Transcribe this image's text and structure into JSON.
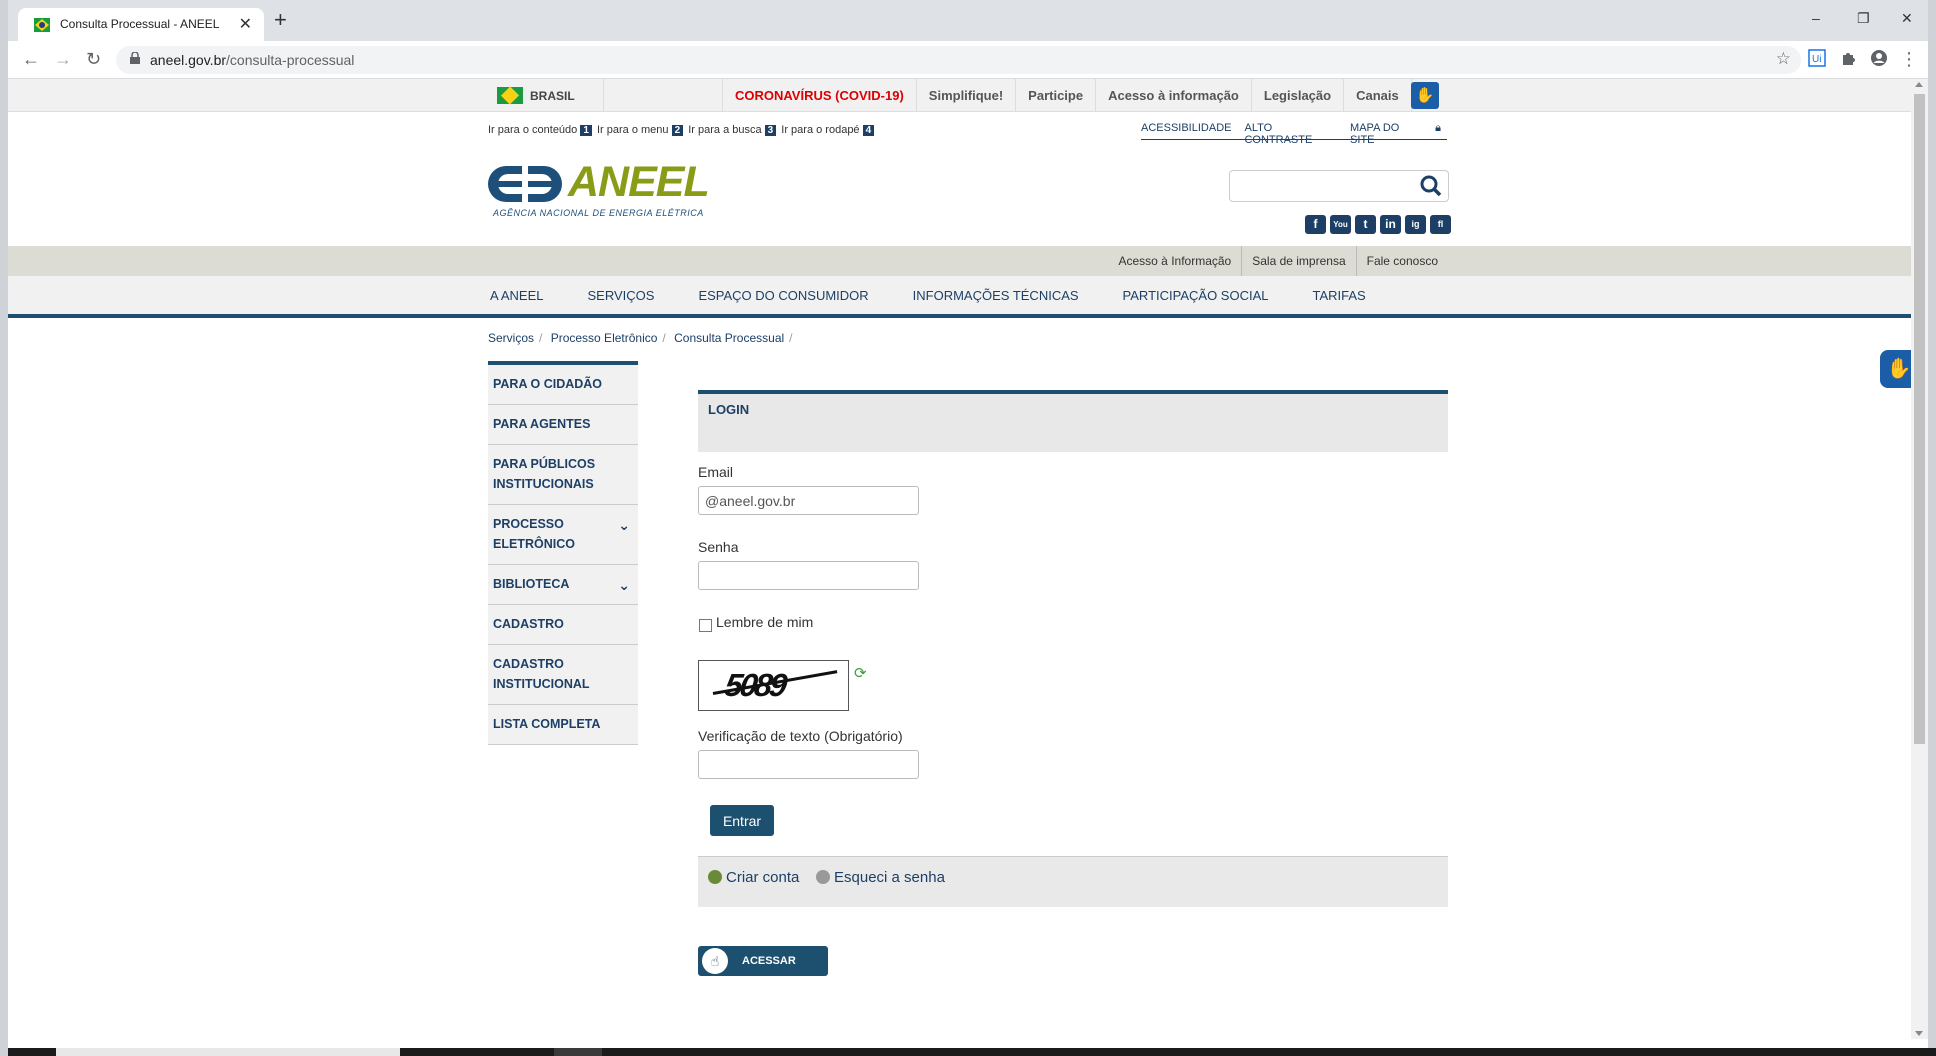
{
  "browser": {
    "tab_title": "Consulta Processual - ANEEL",
    "url_domain": "aneel.gov.br",
    "url_path": "/consulta-processual",
    "new_tab": "+",
    "close": "✕",
    "minimize": "–",
    "restore": "❐",
    "close_window": "✕"
  },
  "govbar": {
    "brasil": "BRASIL",
    "links": [
      "CORONAVÍRUS (COVID-19)",
      "Simplifique!",
      "Participe",
      "Acesso à informação",
      "Legislação",
      "Canais"
    ]
  },
  "skiplinks": [
    {
      "text": "Ir para o conteúdo",
      "key": "1"
    },
    {
      "text": "Ir para o menu",
      "key": "2"
    },
    {
      "text": "Ir para a busca",
      "key": "3"
    },
    {
      "text": "Ir para o rodapé",
      "key": "4"
    }
  ],
  "accessibility": [
    "ACESSIBILIDADE",
    "ALTO CONTRASTE",
    "MAPA DO SITE"
  ],
  "logo": {
    "word": "ANEEL",
    "subtitle": "AGÊNCIA NACIONAL DE ENERGIA ELÉTRICA"
  },
  "search": {
    "placeholder": ""
  },
  "social": [
    "f",
    "You",
    "t",
    "in",
    "ig",
    "fl"
  ],
  "sublinks": [
    "Acesso à Informação",
    "Sala de imprensa",
    "Fale conosco"
  ],
  "mainnav": [
    "A ANEEL",
    "SERVIÇOS",
    "ESPAÇO DO CONSUMIDOR",
    "INFORMAÇÕES TÉCNICAS",
    "PARTICIPAÇÃO SOCIAL",
    "TARIFAS"
  ],
  "breadcrumb": [
    "Serviços",
    "Processo Eletrônico",
    "Consulta Processual"
  ],
  "sidebar": {
    "items": [
      {
        "label": "PARA O CIDADÃO"
      },
      {
        "label": "PARA AGENTES"
      },
      {
        "label": "PARA PÚBLICOS INSTITUCIONAIS"
      },
      {
        "label": "PROCESSO ELETRÔNICO"
      },
      {
        "label": "BIBLIOTECA"
      },
      {
        "label": "CADASTRO"
      },
      {
        "label": "CADASTRO INSTITUCIONAL"
      },
      {
        "label": "LISTA COMPLETA"
      }
    ]
  },
  "login": {
    "title": "LOGIN",
    "email_label": "Email",
    "email_value": "@aneel.gov.br",
    "senha_label": "Senha",
    "senha_value": "",
    "remember_label": "Lembre de mim",
    "captcha_text": "5089",
    "verify_label": "Verificação de texto (Obrigatório)",
    "verify_value": "",
    "submit": "Entrar",
    "create_account": "Criar conta",
    "forgot_password": "Esqueci a senha",
    "acessar": "ACESSAR"
  },
  "colors": {
    "primary": "#1d4f6e",
    "logo_green": "#8a9b18",
    "covid_red": "#dd0000",
    "vlibras_blue": "#1c5da7"
  }
}
